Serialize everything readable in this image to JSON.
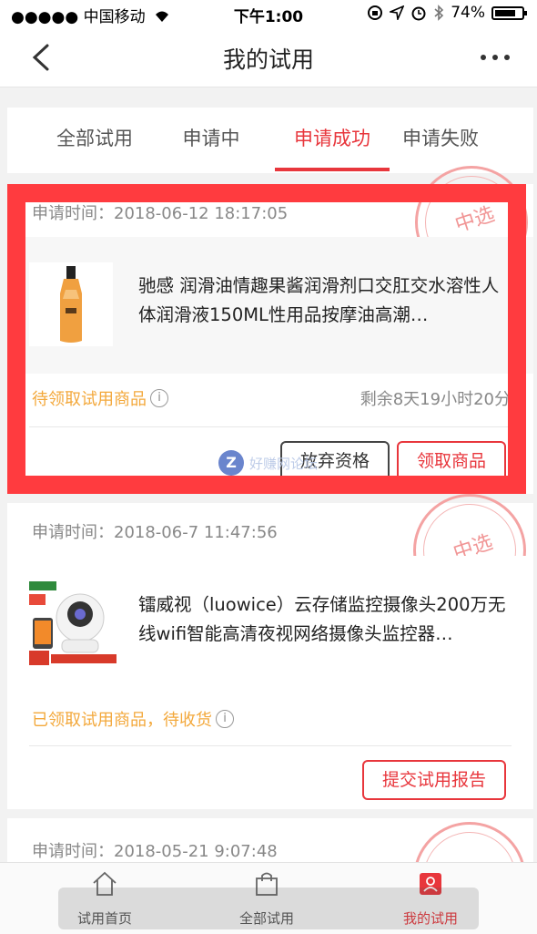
{
  "status_bar": {
    "carrier": "●●●●● 中国移动",
    "time": "下午1:00",
    "battery": "74%"
  },
  "header": {
    "title": "我的试用"
  },
  "tabs": [
    {
      "label": "全部试用"
    },
    {
      "label": "申请中"
    },
    {
      "label": "申请成功",
      "active": true
    },
    {
      "label": "申请失败"
    }
  ],
  "stamp_label": "中选",
  "cards": [
    {
      "time": "申请时间：2018-06-12 18:17:05",
      "title": "驰感 润滑油情趣果酱润滑剂口交肛交水溶性人体润滑液150ML性用品按摩油高潮…",
      "status": "待领取试用商品",
      "countdown": "剩余8天19小时20分",
      "buttons": [
        "放弃资格",
        "领取商品"
      ]
    },
    {
      "time": "申请时间：2018-06-7 11:47:56",
      "title": "镭威视（luowice）云存储监控摄像头200万无线wifi智能高清夜视网络摄像头监控器…",
      "status": "已领取试用商品，待收货",
      "buttons": [
        "提交试用报告"
      ]
    },
    {
      "time": "申请时间：2018-05-21 9:07:48"
    }
  ],
  "watermark": "好赚网论坛",
  "bottom_nav": [
    {
      "label": "试用首页"
    },
    {
      "label": "全部试用"
    },
    {
      "label": "我的试用",
      "active": true
    }
  ],
  "colors": {
    "accent": "#e8363c",
    "status_orange": "#f3a83b",
    "highlight": "#ff3b3f"
  }
}
